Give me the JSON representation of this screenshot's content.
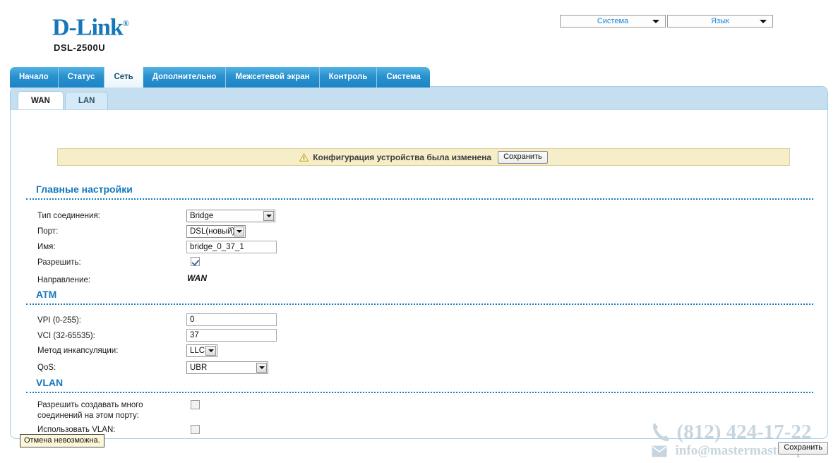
{
  "header": {
    "brand": "D-Link",
    "brand_reg": "®",
    "model": "DSL-2500U",
    "top_selects": [
      {
        "label": "Система",
        "icon": "chevron-down-icon"
      },
      {
        "label": "Язык",
        "icon": "chevron-down-icon"
      }
    ]
  },
  "main_tabs": [
    {
      "label": "Начало",
      "active": false
    },
    {
      "label": "Статус",
      "active": false
    },
    {
      "label": "Сеть",
      "active": true
    },
    {
      "label": "Дополнительно",
      "active": false
    },
    {
      "label": "Межсетевой экран",
      "active": false
    },
    {
      "label": "Контроль",
      "active": false
    },
    {
      "label": "Система",
      "active": false
    }
  ],
  "sub_tabs": [
    {
      "label": "WAN",
      "active": true
    },
    {
      "label": "LAN",
      "active": false
    }
  ],
  "notice": {
    "icon": "warning-icon",
    "text": "Конфигурация устройства была изменена",
    "save_label": "Сохранить"
  },
  "sections": {
    "main": {
      "title": "Главные настройки",
      "connection_type": {
        "label": "Тип соединения:",
        "value": "Bridge"
      },
      "port": {
        "label": "Порт:",
        "value": "DSL(новый)"
      },
      "name": {
        "label": "Имя:",
        "value": "bridge_0_37_1"
      },
      "enable": {
        "label": "Разрешить:",
        "checked": true
      },
      "direction": {
        "label": "Направление:",
        "value": "WAN"
      }
    },
    "atm": {
      "title": "ATM",
      "vpi": {
        "label": "VPI (0-255):",
        "value": "0"
      },
      "vci": {
        "label": "VCI (32-65535):",
        "value": "37"
      },
      "encapsulation": {
        "label": "Метод инкапсуляции:",
        "value": "LLC"
      },
      "qos": {
        "label": "QoS:",
        "value": "UBR"
      }
    },
    "vlan": {
      "title": "VLAN",
      "multi_connections": {
        "label": "Разрешить создавать много соединений на этом порту:",
        "checked": false
      },
      "use_vlan": {
        "label": "Использовать VLAN:",
        "checked": false
      }
    }
  },
  "footer": {
    "save_label": "Сохранить",
    "status_tip": "Отмена невозможна."
  },
  "watermark": {
    "phone": "(812) 424-17-22",
    "email": "info@mastermaster.spb.ru",
    "phone_icon": "phone-icon",
    "mail_icon": "envelope-icon",
    "color": "#c7d5de"
  }
}
